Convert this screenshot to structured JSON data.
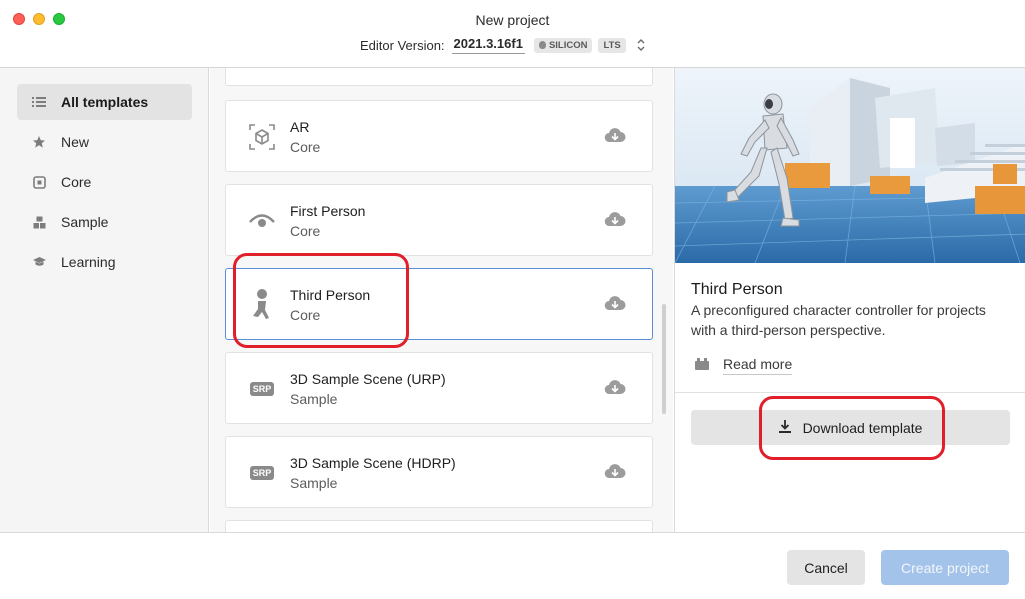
{
  "window": {
    "title": "New project",
    "editor_label": "Editor Version:",
    "editor_version": "2021.3.16f1",
    "badges": [
      "SILICON",
      "LTS"
    ]
  },
  "sidebar": {
    "items": [
      {
        "label": "All templates",
        "icon": "list-icon",
        "active": true
      },
      {
        "label": "New",
        "icon": "star-icon",
        "active": false
      },
      {
        "label": "Core",
        "icon": "core-square-icon",
        "active": false
      },
      {
        "label": "Sample",
        "icon": "sample-blocks-icon",
        "active": false
      },
      {
        "label": "Learning",
        "icon": "graduation-cap-icon",
        "active": false
      }
    ]
  },
  "templates": [
    {
      "title": "AR",
      "category": "Core",
      "icon": "ar-cube-icon"
    },
    {
      "title": "First Person",
      "category": "Core",
      "icon": "eye-icon"
    },
    {
      "title": "Third Person",
      "category": "Core",
      "icon": "running-person-icon",
      "selected": true
    },
    {
      "title": "3D Sample Scene (URP)",
      "category": "Sample",
      "icon": "srp-icon",
      "icon_text": "SRP"
    },
    {
      "title": "3D Sample Scene (HDRP)",
      "category": "Sample",
      "icon": "srp-icon",
      "icon_text": "SRP"
    }
  ],
  "detail": {
    "title": "Third Person",
    "description": "A preconfigured character controller for projects with a third-person perspective.",
    "read_more": "Read more",
    "download_label": "Download template"
  },
  "footer": {
    "cancel_label": "Cancel",
    "create_label": "Create project"
  },
  "colors": {
    "selected_border": "#5b8fd6",
    "create_button": "#a4c3ea",
    "annotation": "#e01f2a"
  }
}
